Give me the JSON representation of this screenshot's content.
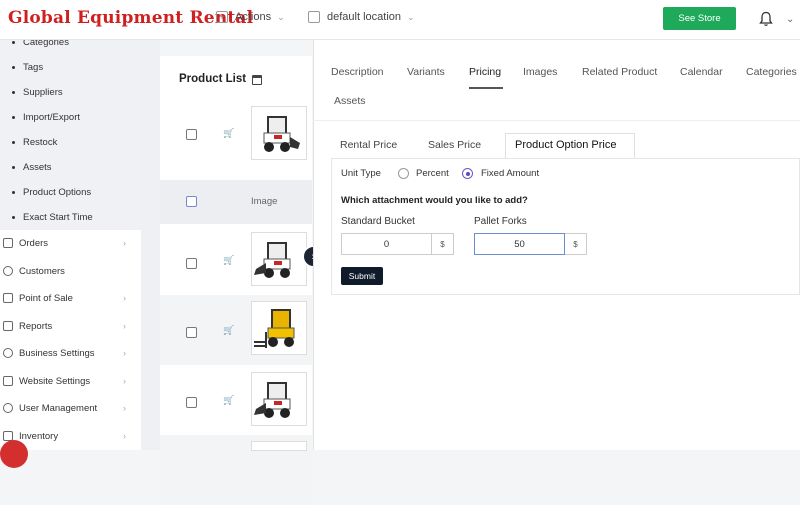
{
  "header": {
    "brand": "Global Equipment Rental",
    "actions_label": "Actions",
    "location_label": "default location",
    "see_store_label": "See Store"
  },
  "sidebar": {
    "sub_items": [
      "Categories",
      "Tags",
      "Suppliers",
      "Import/Export",
      "Restock",
      "Assets",
      "Product Options",
      "Exact Start Time"
    ],
    "main_items": [
      {
        "label": "Orders",
        "arrow": "›"
      },
      {
        "label": "Customers",
        "arrow": ""
      },
      {
        "label": "Point of Sale",
        "arrow": "›"
      },
      {
        "label": "Reports",
        "arrow": "›"
      },
      {
        "label": "Business Settings",
        "arrow": "›"
      },
      {
        "label": "Website Settings",
        "arrow": "›"
      },
      {
        "label": "User Management",
        "arrow": "›"
      },
      {
        "label": "Inventory",
        "arrow": "›"
      }
    ]
  },
  "product_list": {
    "title": "Product List",
    "image_header": "Image"
  },
  "detail": {
    "tabs": [
      "Description",
      "Variants",
      "Pricing",
      "Images",
      "Related Product",
      "Calendar",
      "Categories",
      "Assets"
    ],
    "active_tab": "Pricing",
    "subtabs": [
      "Rental Price",
      "Sales Price",
      "Product Option Price"
    ],
    "active_subtab": "Product Option Price",
    "unit_type_label": "Unit Type",
    "unit_options": [
      "Percent",
      "Fixed Amount"
    ],
    "selected_unit": "Fixed Amount",
    "question": "Which attachment would you like to add?",
    "fields": [
      {
        "label": "Standard Bucket",
        "value": "0",
        "suffix": "$"
      },
      {
        "label": "Pallet Forks",
        "value": "50",
        "suffix": "$"
      }
    ],
    "submit_label": "Submit"
  }
}
